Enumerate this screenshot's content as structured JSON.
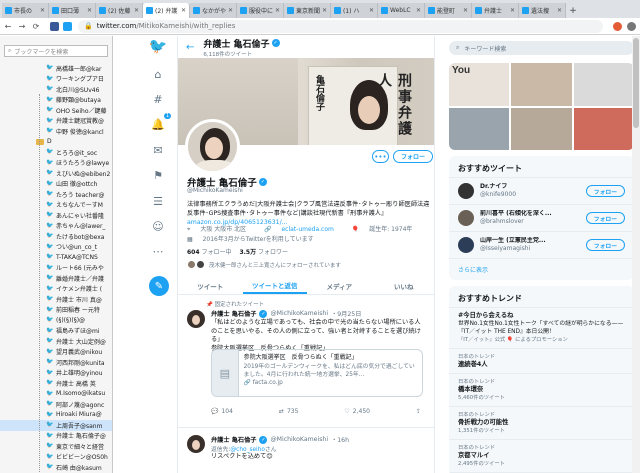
{
  "browser": {
    "tabs": [
      {
        "label": "市長の",
        "active": false
      },
      {
        "label": "田口薄",
        "active": false
      },
      {
        "label": "(2) 佐藤",
        "active": false
      },
      {
        "label": "(2) 弁護",
        "active": true
      },
      {
        "label": "なかがや",
        "active": false
      },
      {
        "label": "服役中に",
        "active": false
      },
      {
        "label": "東京新聞",
        "active": false
      },
      {
        "label": "(1) ハ",
        "active": false
      },
      {
        "label": "WebLC",
        "active": false
      },
      {
        "label": "能登町",
        "active": false
      },
      {
        "label": "弁護士",
        "active": false
      },
      {
        "label": "遺法捜",
        "active": false
      }
    ],
    "url_host": "twitter.com",
    "url_path": "/MitikoKameishi/with_replies"
  },
  "sidebar": {
    "search_placeholder": "ブックマークを検索",
    "items": [
      {
        "label": "高橋雄一郎@kar",
        "type": "item"
      },
      {
        "label": "ワーキングプア日",
        "type": "item"
      },
      {
        "label": "北白川@SUv46",
        "type": "item"
      },
      {
        "label": "藤野顕@butaya",
        "type": "item"
      },
      {
        "label": "OHO Seiho／鍵藤",
        "type": "item"
      },
      {
        "label": "弁護士鍵冠賞教@",
        "type": "item"
      },
      {
        "label": "中野 俊徳@kancl",
        "type": "item"
      },
      {
        "label": "D",
        "type": "folder"
      },
      {
        "label": "とろろ@it_soc",
        "type": "item"
      },
      {
        "label": "ほうたろう@lawye",
        "type": "item"
      },
      {
        "label": "えびいぬ@ebiben2",
        "type": "item"
      },
      {
        "label": "山田 徹@ottch",
        "type": "item"
      },
      {
        "label": "たろう teacher@",
        "type": "item"
      },
      {
        "label": "えちなんでーすM",
        "type": "item"
      },
      {
        "label": "あんにゃい社番隆",
        "type": "item"
      },
      {
        "label": "赤ちゃん@lawer_",
        "type": "item"
      },
      {
        "label": "たけるbot@bexa",
        "type": "item"
      },
      {
        "label": "つい@un_co_t",
        "type": "item"
      },
      {
        "label": "T-TAKA@TCNS",
        "type": "item"
      },
      {
        "label": "ルート66 (元みや",
        "type": "item"
      },
      {
        "label": "離婚弁護士／弁護",
        "type": "item"
      },
      {
        "label": "イケメン弁護士 (",
        "type": "item"
      },
      {
        "label": "弁護士 市川 真@",
        "type": "item"
      },
      {
        "label": "前田稲春 ー元特",
        "type": "item"
      },
      {
        "label": "(§)(§)(§)@",
        "type": "item"
      },
      {
        "label": "福島みずほ@mi",
        "type": "item"
      },
      {
        "label": "弁護士 大山定例@",
        "type": "item"
      },
      {
        "label": "望月義武@nikou",
        "type": "item"
      },
      {
        "label": "河西邦剛@kunita",
        "type": "item"
      },
      {
        "label": "井上雄明@yinou",
        "type": "item"
      },
      {
        "label": "弁護士 高橋 英",
        "type": "item"
      },
      {
        "label": "M.Isomo@ikatsu",
        "type": "item"
      },
      {
        "label": "阿部ノ蔑@agonc",
        "type": "item"
      },
      {
        "label": "Hiroaki Miura@",
        "type": "item"
      },
      {
        "label": "上周吾子@sanm",
        "type": "item",
        "selected": true
      },
      {
        "label": "弁護士 亀石倫子@",
        "type": "item"
      },
      {
        "label": "東京で細々と経営",
        "type": "item"
      },
      {
        "label": "ビビビーン@OS0h",
        "type": "item"
      },
      {
        "label": "石崎 由@kasum",
        "type": "item"
      }
    ]
  },
  "rail": {
    "notif_badge": "1"
  },
  "profile": {
    "header_name": "弁護士 亀石倫子",
    "header_count": "6,118件のツイート",
    "book_title": "刑事弁護人",
    "book_author": "亀石倫子",
    "name": "弁護士 亀石倫子",
    "handle": "@MichikoKameishi",
    "follow_label": "フォロー",
    "more_label": "•••",
    "bio": "法律事務所エクラうめだ|大阪弁護士会|クラブ風営法違反事件･タトゥー彫り師医師法違反事件･GPS捜査事件･タトゥー事件など|講談社現代新書『刑事弁護人』",
    "bio_link": "amazon.co.jp/dp/4065123631/...",
    "location": "大阪 大阪市 北区",
    "site": "eclat-umeda.com",
    "born": "誕生年: 1974年",
    "joined": "2016年3月からTwitterを利用しています",
    "following_count": "604",
    "following_label": "フォロー中",
    "followers_count": "3.5万",
    "followers_label": "フォロワー",
    "known": "茂木健一郎さんと三上寛さんにフォローされています"
  },
  "tabs": [
    {
      "label": "ツイート",
      "active": false
    },
    {
      "label": "ツイートと返信",
      "active": true
    },
    {
      "label": "メディア",
      "active": false
    },
    {
      "label": "いいね",
      "active": false
    }
  ],
  "tweets": [
    {
      "pinned": "固定されたツイート",
      "name": "弁護士 亀石倫子",
      "handle": "@MichikoKameishi",
      "time": "・9月25日",
      "text": "「私はどのような立場であっても、社会の中で光の当たらない場所にいる人のことを思いやる、その人の側に立って、強い者と対峙することを選び続ける」\n参院大阪選挙区　反骨つらぬく「重戦記」",
      "card_title": "参院大阪選挙区　反骨つらぬく「重戦記」",
      "card_desc": "2019年のゴールデンウィークを、私はどん底の気分で過ごしていました。4月に行われた統一地方選挙、25年...",
      "card_link": "facta.co.jp",
      "replies": "104",
      "retweets": "735",
      "likes": "2,450"
    },
    {
      "name": "弁護士 亀石倫子",
      "handle": "@MichikoKameishi",
      "time": "・16h",
      "reply_prefix": "返信先:",
      "reply_to": "@cho_seiho",
      "reply_suffix": "さん",
      "text": "リスペクトを込めて😊"
    }
  ],
  "right": {
    "search_placeholder": "キーワード検索",
    "suggestions_title": "おすすめツイート",
    "suggestions": [
      {
        "name": "Dr.ナイフ",
        "handle": "@knife9000",
        "color": "#333333"
      },
      {
        "name": "前川喜平 (右傾化を深く...",
        "handle": "@brahmslover",
        "color": "#6b6055"
      },
      {
        "name": "山岸一生 (立憲民主党...",
        "handle": "@Isseiyamagishi",
        "color": "#2c3e57"
      }
    ],
    "follow_label": "フォロー",
    "more_label": "さらに表示",
    "trends_title": "おすすめトレンド",
    "trends": [
      {
        "tag": "#今日から会えるね",
        "desc": "世界No.1女性No.1女性トーク「すべての謎が明らかになる——『IT／イット THE END』本日公開！",
        "prom": "『IT／イット』公式 🎈 によるプロモーション"
      },
      {
        "loc": "日本のトレンド",
        "tag": "連続巻4人"
      },
      {
        "loc": "日本のトレンド",
        "tag": "橋本環奈",
        "cnt": "5,460件のツイート"
      },
      {
        "loc": "日本のトレンド",
        "tag": "骨折戦力の可能性",
        "cnt": "1,351件のツイート"
      },
      {
        "loc": "日本のトレンド",
        "tag": "京都マルイ",
        "cnt": "2,495件のツイート"
      }
    ]
  }
}
